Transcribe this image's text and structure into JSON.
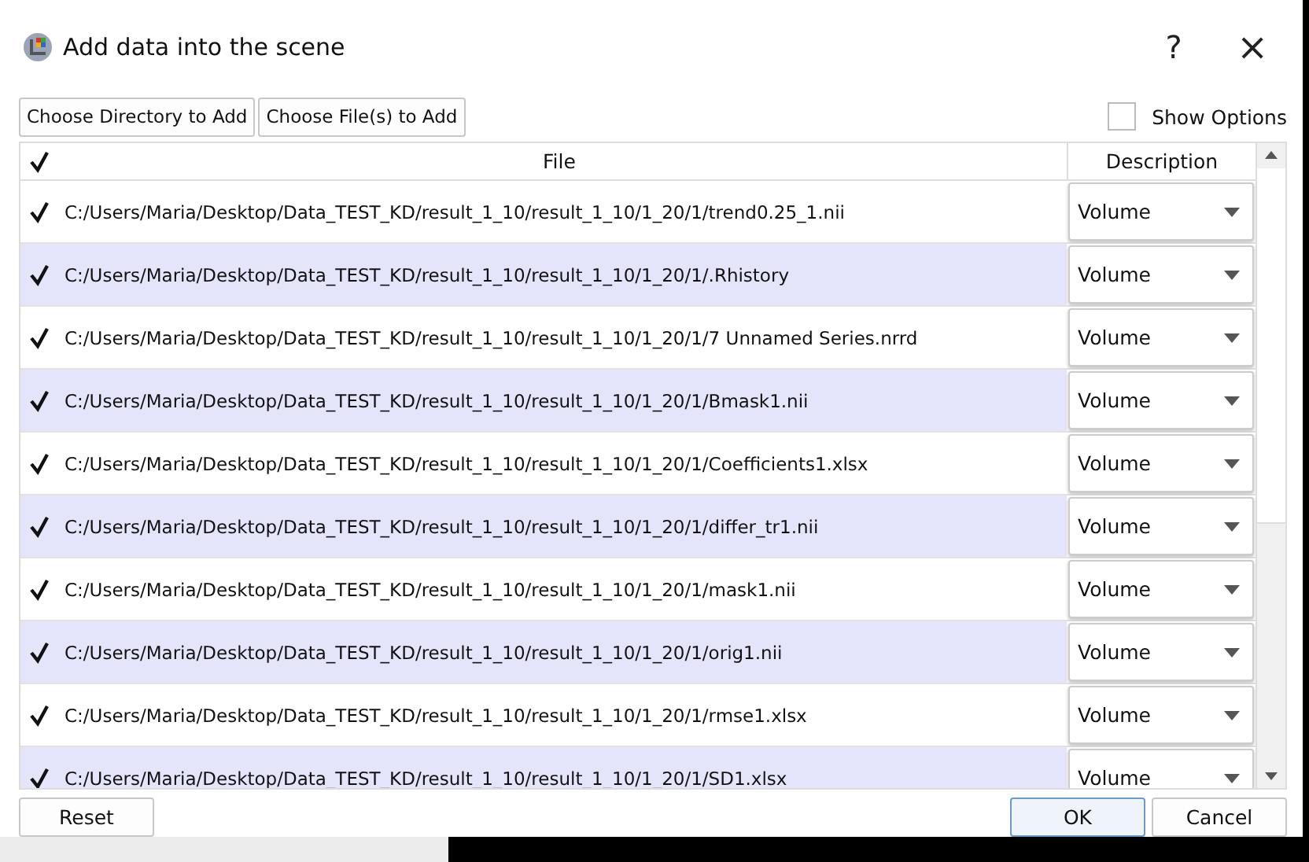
{
  "window": {
    "title": "Add data into the scene",
    "help": "?",
    "close": "×"
  },
  "toolbar": {
    "buttons": [
      "Choose Directory to Add",
      "Choose File(s) to Add"
    ],
    "show_options": {
      "label": "Show Options",
      "checked": false
    }
  },
  "table": {
    "header_checked": true,
    "columns": [
      "File",
      "Description"
    ],
    "rows": [
      {
        "checked": true,
        "file": "C:/Users/Maria/Desktop/Data_TEST_KD/result_1_10/result_1_10/1_20/1/trend0.25_1.nii",
        "description": "Volume"
      },
      {
        "checked": true,
        "file": "C:/Users/Maria/Desktop/Data_TEST_KD/result_1_10/result_1_10/1_20/1/.Rhistory",
        "description": "Volume"
      },
      {
        "checked": true,
        "file": "C:/Users/Maria/Desktop/Data_TEST_KD/result_1_10/result_1_10/1_20/1/7 Unnamed Series.nrrd",
        "description": "Volume"
      },
      {
        "checked": true,
        "file": "C:/Users/Maria/Desktop/Data_TEST_KD/result_1_10/result_1_10/1_20/1/Bmask1.nii",
        "description": "Volume"
      },
      {
        "checked": true,
        "file": "C:/Users/Maria/Desktop/Data_TEST_KD/result_1_10/result_1_10/1_20/1/Coefficients1.xlsx",
        "description": "Volume"
      },
      {
        "checked": true,
        "file": "C:/Users/Maria/Desktop/Data_TEST_KD/result_1_10/result_1_10/1_20/1/differ_tr1.nii",
        "description": "Volume"
      },
      {
        "checked": true,
        "file": "C:/Users/Maria/Desktop/Data_TEST_KD/result_1_10/result_1_10/1_20/1/mask1.nii",
        "description": "Volume"
      },
      {
        "checked": true,
        "file": "C:/Users/Maria/Desktop/Data_TEST_KD/result_1_10/result_1_10/1_20/1/orig1.nii",
        "description": "Volume"
      },
      {
        "checked": true,
        "file": "C:/Users/Maria/Desktop/Data_TEST_KD/result_1_10/result_1_10/1_20/1/rmse1.xlsx",
        "description": "Volume"
      },
      {
        "checked": true,
        "file": "C:/Users/Maria/Desktop/Data_TEST_KD/result_1_10/result_1_10/1_20/1/SD1.xlsx",
        "description": "Volume"
      }
    ]
  },
  "footer": {
    "reset": "Reset",
    "ok": "OK",
    "cancel": "Cancel"
  }
}
